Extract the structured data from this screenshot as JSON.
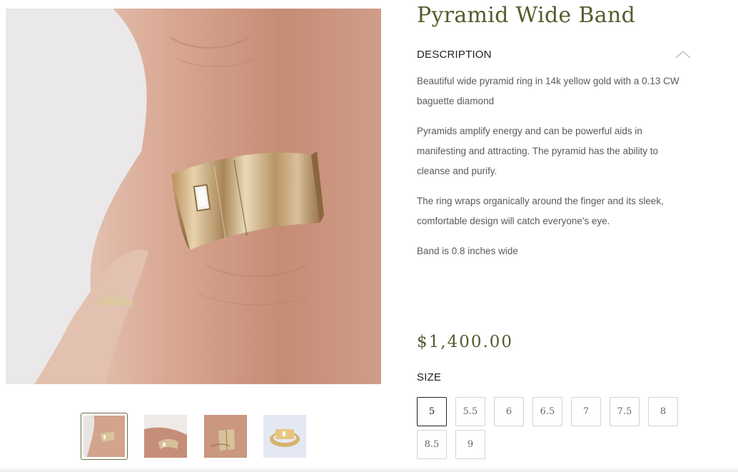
{
  "product": {
    "title": "Pyramid Wide Band",
    "description_heading": "DESCRIPTION",
    "description": [
      "Beautiful wide pyramid ring in 14k yellow gold with a 0.13 CW baguette diamond",
      "Pyramids amplify energy and can be powerful aids in manifesting and attracting. The pyramid has the ability to cleanse and purify.",
      "The ring wraps organically around the finger and its sleek, comfortable design will catch everyone's eye.",
      "Band is 0.8 inches wide"
    ],
    "price": "$1,400.00",
    "size_label": "SIZE",
    "sizes": [
      "5",
      "5.5",
      "6",
      "6.5",
      "7",
      "7.5",
      "8",
      "8.5",
      "9"
    ],
    "selected_size": "5"
  },
  "gallery": {
    "thumbnail_count": 4,
    "active_thumbnail": 1
  },
  "colors": {
    "title": "#585a2e",
    "price": "#585a2e",
    "selected_border": "#222222",
    "active_thumb_border": "#6b6b45"
  }
}
